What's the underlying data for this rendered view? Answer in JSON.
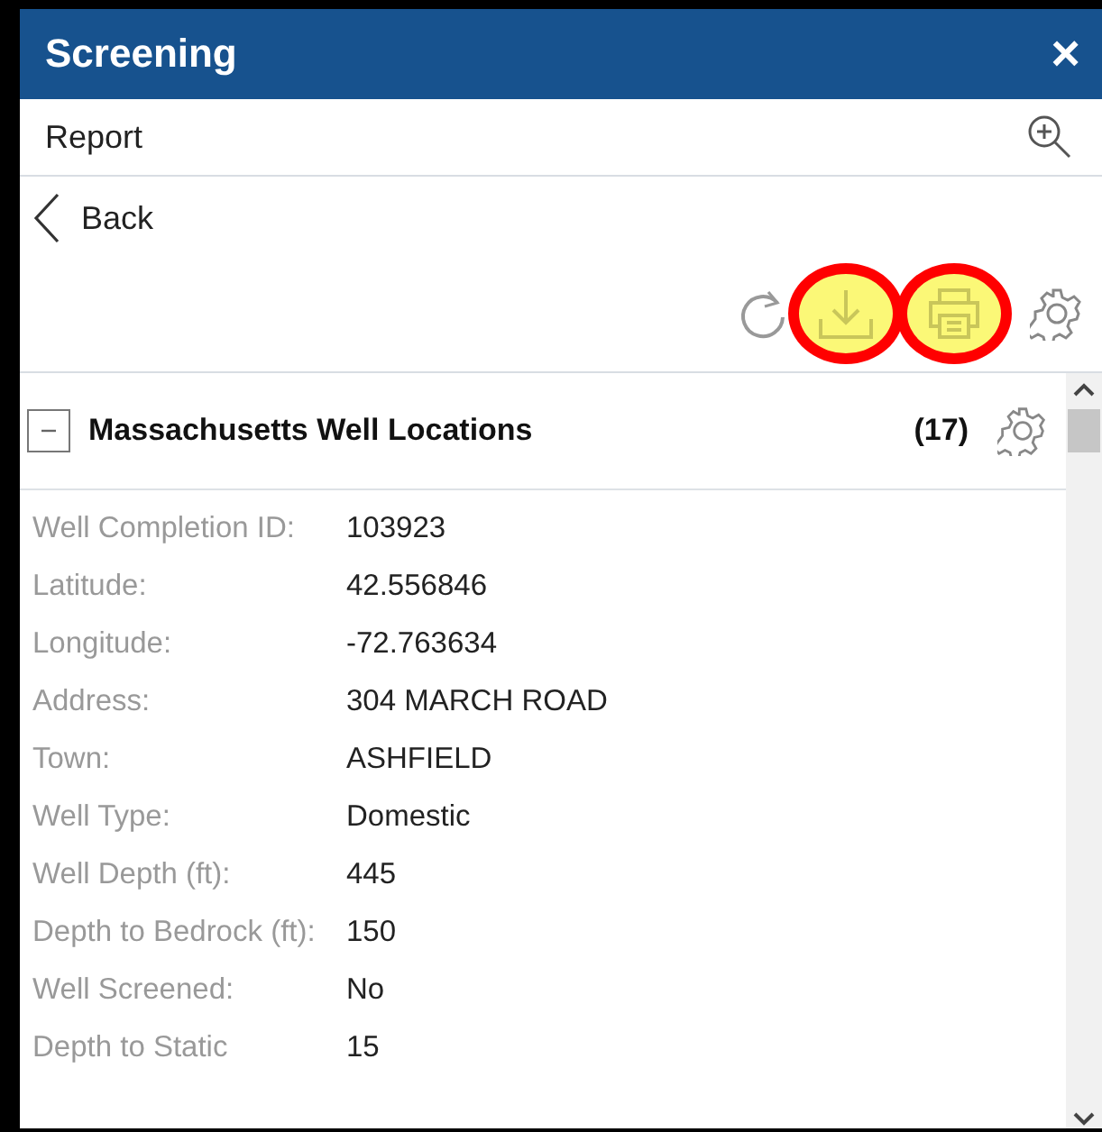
{
  "window": {
    "title": "Screening",
    "close": "×"
  },
  "report": {
    "title": "Report"
  },
  "back": {
    "label": "Back"
  },
  "tools": [
    {
      "kind": "refresh",
      "highlighted": false
    },
    {
      "kind": "download",
      "highlighted": true
    },
    {
      "kind": "print",
      "highlighted": true
    },
    {
      "kind": "settings",
      "highlighted": false
    }
  ],
  "layer": {
    "title": "Massachusetts Well Locations",
    "count": "(17)",
    "expanded": true
  },
  "fields": [
    {
      "label": "Well Completion ID:",
      "value": "103923"
    },
    {
      "label": "Latitude:",
      "value": "42.556846"
    },
    {
      "label": "Longitude:",
      "value": "-72.763634"
    },
    {
      "label": "Address:",
      "value": "304 MARCH ROAD"
    },
    {
      "label": "Town:",
      "value": "ASHFIELD"
    },
    {
      "label": "Well Type:",
      "value": "Domestic"
    },
    {
      "label": "Well Depth (ft):",
      "value": "445"
    },
    {
      "label": "Depth to Bedrock (ft):",
      "value": "150"
    },
    {
      "label": "Well Screened:",
      "value": "No"
    },
    {
      "label": "Depth to Static",
      "value": "15"
    }
  ]
}
